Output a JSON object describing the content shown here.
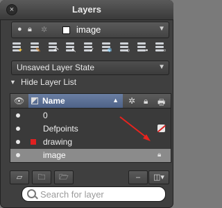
{
  "window": {
    "title": "Layers"
  },
  "current_layer": {
    "name": "image"
  },
  "layer_state": {
    "value": "Unsaved Layer State"
  },
  "list_toggle": {
    "label": "Hide Layer List"
  },
  "list": {
    "columns": {
      "name": "Name"
    },
    "rows": [
      {
        "name": "0",
        "color": "#ffffff",
        "status": ""
      },
      {
        "name": "Defpoints",
        "color": "#ffffff",
        "status": "no-plot"
      },
      {
        "name": "drawing",
        "color": "#e02020",
        "status": ""
      },
      {
        "name": "image",
        "color": "#ffffff",
        "status": "lock",
        "selected": true
      }
    ]
  },
  "bottom_bar": {
    "minus_label": "–"
  },
  "search": {
    "placeholder": "Search for layer"
  },
  "accent": {
    "annotation_arrow": "#e8231e",
    "name_header": "#5b6f95"
  }
}
